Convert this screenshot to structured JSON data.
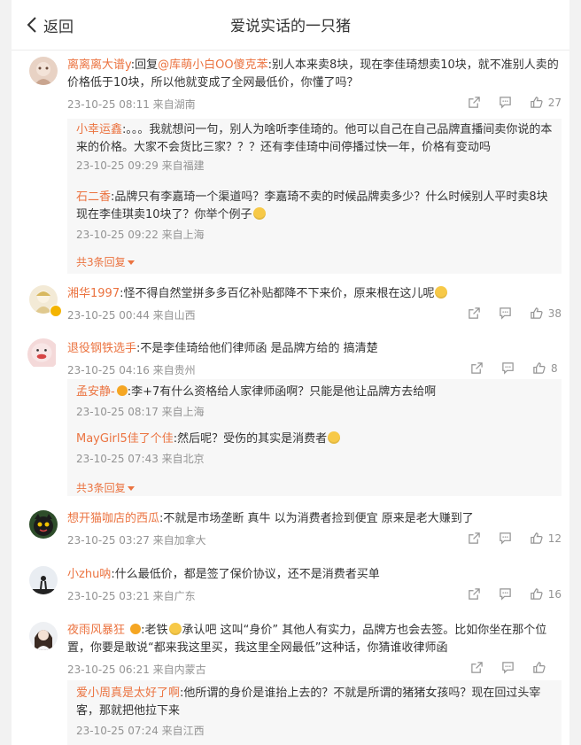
{
  "header": {
    "back_label": "返回",
    "title": "爱说实话的一只猪"
  },
  "more_replies_label": "共3条回复",
  "comments": [
    {
      "user": "离离离大谱y",
      "prefix": ":回复",
      "mention": "@库萌小白OO傻克苯",
      "text": ":别人本来卖8块，现在李佳琦想卖10块，就不准别人卖的价格低于10块，所以他就变成了全网最低价，你懂了吗？",
      "meta": "23-10-25 08:11 来自湖南",
      "likes": "27"
    },
    {
      "user": "湘华1997",
      "text": ":怪不得自然堂拼多多百亿补贴都降不下来价，原来根在这儿呢",
      "meta": "23-10-25 00:44 来自山西",
      "likes": "38"
    },
    {
      "user": "退役钢铁选手",
      "text": ":不是李佳琦给他们律师函 是品牌方给的 搞清楚",
      "meta": "23-10-25 04:16 来自贵州",
      "likes": "8"
    },
    {
      "user": "想开猫咖店的西瓜",
      "text": ":不就是市场垄断 真牛 以为消费者捡到便宜  原来是老大赚到了",
      "meta": "23-10-25 03:27 来自加拿大",
      "likes": "12"
    },
    {
      "user": "小zhu呐",
      "text": ":什么最低价，都是签了保价协议，还不是消费者买单",
      "meta": "23-10-25 03:21 来自广东",
      "likes": "16"
    },
    {
      "user": "夜雨风暴狂",
      "text_a": ":老铁",
      "text_b": "承认吧 这叫“身价” 其他人有实力，品牌方也会去签。比如你坐在那个位置，你要是敢说“都来我这里买，我这里全网最低”这种话，你猜谁收律师函",
      "meta": "23-10-25 06:21 来自内蒙古",
      "likes": ""
    }
  ],
  "replies": [
    {
      "user": "小幸运鑫",
      "text": ":。。。我就想问一句，别人为啥听李佳琦的。他可以自己在自己品牌直播间卖你说的本来的价格。大家不会货比三家？？？还有李佳琦中间停播过快一年，价格有变动吗",
      "meta": "23-10-25 09:29 来自福建"
    },
    {
      "user": "石二香",
      "text": ":品牌只有李嘉琦一个渠道吗？李嘉琦不卖的时候品牌卖多少？什么时候别人平时卖8块现在李佳琪卖10块了？你举个例子",
      "meta": "23-10-25 09:22 来自上海"
    },
    {
      "user": "孟安静-",
      "text": ":李+7有什么资格给人家律师函啊？只能是他让品牌方去给啊",
      "meta": "23-10-25 08:17 来自上海"
    },
    {
      "user": "MayGirl5佳了个佳",
      "text": ":然后呢？受伤的其实是消费者",
      "meta": "23-10-25 07:43 来自北京"
    },
    {
      "user": "爱小周真是太好了啊",
      "text": ":他所谓的身价是谁抬上去的？不就是所谓的猪猪女孩吗？现在回过头宰客，那就把他拉下来",
      "meta": "23-10-25 07:24 来自江西"
    }
  ],
  "icons": {
    "back": "chevron-left-icon",
    "share": "share-icon",
    "comment": "comment-icon",
    "like": "thumbs-up-icon"
  },
  "colors": {
    "accent": "#eb7340",
    "meta": "#939393",
    "reply_bg": "#f7f7f7"
  }
}
